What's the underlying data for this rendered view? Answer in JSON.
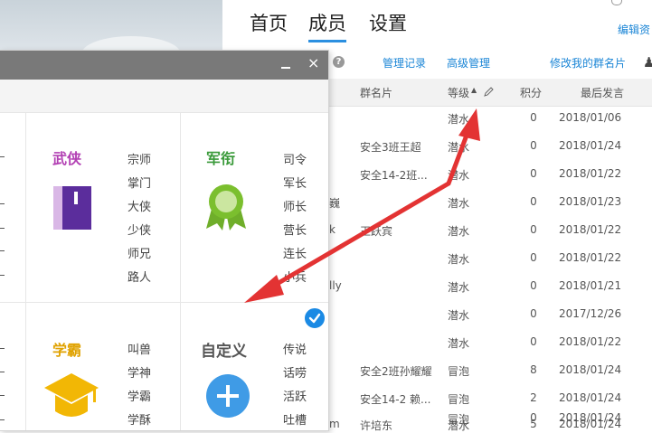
{
  "nav": {
    "home": "首页",
    "members": "成员",
    "settings": "设置",
    "edit_link": "编辑资"
  },
  "toolbar": {
    "manage_log": "管理记录",
    "advanced": "高级管理",
    "edit_card": "修改我的群名片"
  },
  "table": {
    "headers": {
      "card": "群名片",
      "level": "等级",
      "points": "积分",
      "last_post": "最后发言"
    },
    "rows": [
      {
        "name": "",
        "card": "",
        "level": "潜水",
        "points": "0",
        "date": "2018/01/06"
      },
      {
        "name": "",
        "card": "安全3班王超",
        "level": "潜水",
        "points": "0",
        "date": "2018/01/24"
      },
      {
        "name": "",
        "card": "安全14-2班...",
        "level": "潜水",
        "points": "0",
        "date": "2018/01/22"
      },
      {
        "name": "巍",
        "card": "",
        "level": "潜水",
        "points": "0",
        "date": "2018/01/23"
      },
      {
        "name": "k",
        "card": "王跃宾",
        "level": "潜水",
        "points": "0",
        "date": "2018/01/22"
      },
      {
        "name": "",
        "card": "",
        "level": "潜水",
        "points": "0",
        "date": "2018/01/22"
      },
      {
        "name": "lly",
        "card": "",
        "level": "潜水",
        "points": "0",
        "date": "2018/01/21"
      },
      {
        "name": "",
        "card": "",
        "level": "潜水",
        "points": "0",
        "date": "2017/12/26"
      },
      {
        "name": "",
        "card": "",
        "level": "潜水",
        "points": "0",
        "date": "2018/01/22"
      },
      {
        "name": "",
        "card": "安全2班孙耀耀",
        "level": "冒泡",
        "points": "8",
        "date": "2018/01/24"
      },
      {
        "name": "",
        "card": "安全14-2 赖...",
        "level": "冒泡",
        "points": "2",
        "date": "2018/01/24"
      },
      {
        "name": "",
        "card": "",
        "level": "冒泡",
        "points": "0",
        "date": "2018/01/24"
      },
      {
        "name": "m",
        "card": "许培东",
        "level": "潜水",
        "points": "5",
        "date": "2018/01/24"
      }
    ]
  },
  "dialog": {
    "min_label": "",
    "close_label": "×",
    "cards": {
      "wuxia": {
        "title": "武侠",
        "color": "#b23fb3",
        "items": [
          "宗师",
          "掌门",
          "大侠",
          "少侠",
          "师兄",
          "路人"
        ]
      },
      "junxian": {
        "title": "军衔",
        "color": "#3a9a3a",
        "items": [
          "司令",
          "军长",
          "师长",
          "营长",
          "连长",
          "小兵"
        ]
      },
      "xueba": {
        "title": "学霸",
        "color": "#e0a200",
        "items": [
          "叫兽",
          "学神",
          "学霸",
          "学酥"
        ]
      },
      "custom": {
        "title": "自定义",
        "color": "#555555",
        "items": [
          "传说",
          "话唠",
          "活跃",
          "吐槽"
        ]
      }
    }
  },
  "colors": {
    "accent": "#1a85d6",
    "arrow": "#e33333"
  }
}
